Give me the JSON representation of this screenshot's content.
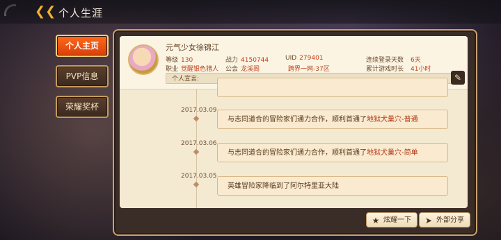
{
  "header": {
    "title": "个人生涯",
    "back_icon": "back-arrow-icon"
  },
  "side_tabs": [
    {
      "label": "个人主页",
      "active": true
    },
    {
      "label": "PVP信息",
      "active": false
    },
    {
      "label": "荣耀奖杯",
      "active": false
    }
  ],
  "profile": {
    "name": "元气少女徐锦江",
    "level_label": "等级",
    "level_value": "130",
    "job_label": "职业",
    "job_value": "觉醒银色猎人",
    "power_label": "战力",
    "power_value": "4150744",
    "guild_label": "公会",
    "guild_value": "龙溪阁",
    "uid_label": "UID",
    "uid_value": "279401",
    "server_value": "跨界一网-37区",
    "login_days_label": "连续登录天数",
    "login_days_value": "6天",
    "play_time_label": "累计游戏时长",
    "play_time_value": "41小时",
    "declaration_label": "个人宣言:"
  },
  "timeline": [
    {
      "date": "2017.03.09",
      "prefix": "与志同道合的冒险家们通力合作，顺利首通了",
      "highlight": "地狱犬巢穴-普通"
    },
    {
      "date": "2017.03.06",
      "prefix": "与志同道合的冒险家们通力合作，顺利首通了",
      "highlight": "地狱犬巢穴-简单"
    },
    {
      "date": "2017.03.05",
      "prefix": "英雄冒险家降临到了阿尔特里亚大陆",
      "highlight": ""
    }
  ],
  "actions": {
    "show_off_label": "炫耀一下",
    "share_label": "外部分享"
  },
  "colors": {
    "accent": "#f3b12c",
    "active_tab": "#e8551a",
    "highlight_text": "#b43b1a"
  }
}
